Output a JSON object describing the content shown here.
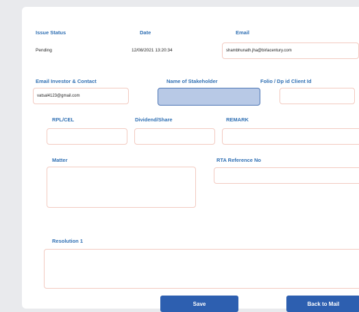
{
  "header_row": {
    "issue_status_label": "Issue Status",
    "date_label": "Date",
    "email_label": "Email",
    "issue_status_value": "Pending",
    "date_value": "12/08/2021 13:20:34",
    "email_value": "shambhunath.jha@birlacentury.com"
  },
  "fields": {
    "email_investor_label": "Email Investor & Contact",
    "email_investor_value": "vatsal4123@gmail.com",
    "stakeholder_label": "Name of Stakeholder",
    "folio_label": "Folio / Dp id Client Id",
    "rpl_label": "RPL/CEL",
    "dividend_label": "Dividend/Share",
    "remark_label": "REMARK",
    "matter_label": "Matter",
    "rta_label": "RTA Reference No",
    "resolution_label": "Resolution 1"
  },
  "buttons": {
    "save": "Save",
    "back": "Back to Mail"
  }
}
